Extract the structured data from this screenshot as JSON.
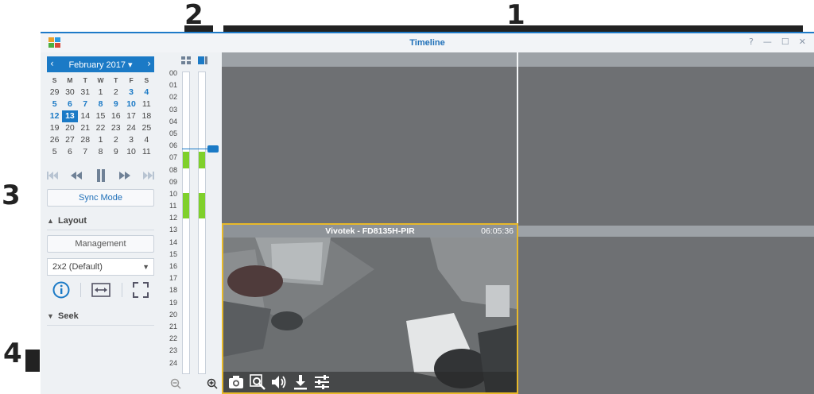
{
  "window": {
    "title": "Timeline",
    "controls": [
      "?",
      "—",
      "☐",
      "✕"
    ]
  },
  "callouts": {
    "c1": "1",
    "c2": "2",
    "c3": "3",
    "c4": "4"
  },
  "calendar": {
    "month_label": "February 2017 ▾",
    "prev": "‹",
    "next": "›",
    "weekdays": [
      "S",
      "M",
      "T",
      "W",
      "T",
      "F",
      "S"
    ],
    "weeks": [
      [
        "29",
        "30",
        "31",
        "1",
        "2",
        "3",
        "4"
      ],
      [
        "5",
        "6",
        "7",
        "8",
        "9",
        "10",
        "11"
      ],
      [
        "12",
        "13",
        "14",
        "15",
        "16",
        "17",
        "18"
      ],
      [
        "19",
        "20",
        "21",
        "22",
        "23",
        "24",
        "25"
      ],
      [
        "26",
        "27",
        "28",
        "1",
        "2",
        "3",
        "4"
      ],
      [
        "5",
        "6",
        "7",
        "8",
        "9",
        "10",
        "11"
      ]
    ],
    "recorded_days": [
      "3",
      "4",
      "5",
      "6",
      "7",
      "8",
      "9",
      "10",
      "12"
    ],
    "selected_day": "13"
  },
  "playback": {
    "controls": [
      "skip-start",
      "rewind",
      "pause",
      "fast-forward",
      "skip-end"
    ]
  },
  "sync_mode_label": "Sync Mode",
  "layout": {
    "section_label": "Layout",
    "management_label": "Management",
    "selected_layout": "2x2 (Default)"
  },
  "seek": {
    "section_label": "Seek"
  },
  "timeline": {
    "hours": [
      "00",
      "01",
      "02",
      "03",
      "04",
      "05",
      "06",
      "07",
      "08",
      "09",
      "10",
      "11",
      "12",
      "13",
      "14",
      "15",
      "16",
      "17",
      "18",
      "19",
      "20",
      "21",
      "22",
      "23",
      "24"
    ],
    "recordings": [
      {
        "start_hour": 6.3,
        "end_hour": 7.6
      },
      {
        "start_hour": 9.6,
        "end_hour": 11.6
      }
    ],
    "current_hour": 6.1,
    "colors": {
      "recording": "#7fd02b",
      "cursor": "#1b7ac6"
    }
  },
  "camera": {
    "name": "Vivotek - FD8135H-PIR",
    "time": "06:05:36",
    "tools": [
      "camera-icon",
      "zoom-icon",
      "volume-icon",
      "download-icon",
      "settings-sliders-icon"
    ],
    "highlight_color": "#e8b92a"
  }
}
